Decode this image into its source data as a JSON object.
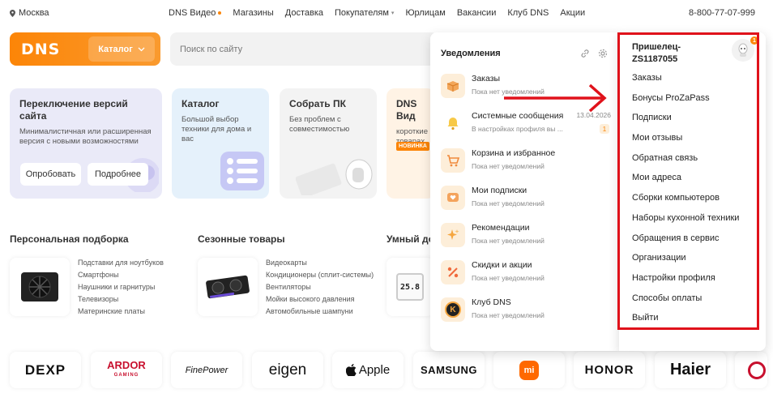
{
  "topbar": {
    "city": "Москва",
    "nav": [
      {
        "label": "DNS Видео",
        "dot": true
      },
      {
        "label": "Магазины"
      },
      {
        "label": "Доставка"
      },
      {
        "label": "Покупателям",
        "chevron": true
      },
      {
        "label": "Юрлицам"
      },
      {
        "label": "Вакансии"
      },
      {
        "label": "Клуб DNS"
      },
      {
        "label": "Акции"
      }
    ],
    "phone": "8-800-77-07-999"
  },
  "header": {
    "logo": "DNS",
    "catalog_label": "Каталог",
    "search_placeholder": "Поиск по сайту"
  },
  "cards": {
    "switch": {
      "title": "Переключение версий сайта",
      "text": "Минималистичная или расширенная версия с новыми возможностями",
      "try_label": "Опробовать",
      "more_label": "Подробнее"
    },
    "catalog": {
      "title": "Каталог",
      "text": "Большой выбор техники для дома и вас"
    },
    "build_pc": {
      "title": "Собрать ПК",
      "text": "Без проблем с совместимостью"
    },
    "video": {
      "title": "DNS Вид",
      "text": "короткие товарах",
      "badge": "НОВИНКА"
    }
  },
  "sections": {
    "personal": {
      "title": "Персональная подборка",
      "items": [
        "Подставки для ноутбуков",
        "Смартфоны",
        "Наушники и гарнитуры",
        "Телевизоры",
        "Материнские платы"
      ]
    },
    "seasonal": {
      "title": "Сезонные товары",
      "items": [
        "Видеокарты",
        "Кондиционеры (сплит-системы)",
        "Вентиляторы",
        "Мойки высокого давления",
        "Автомобильные шампуни"
      ]
    },
    "smart": {
      "title": "Умный до",
      "screen_text": "25.8"
    }
  },
  "brands": [
    "DEXP",
    "ARDOR",
    "FinePower",
    "eigen",
    "Apple",
    "SAMSUNG",
    "mi",
    "HONOR",
    "Haier"
  ],
  "brand_sub": {
    "ardor": "GAMING"
  },
  "notifications": {
    "title": "Уведомления",
    "items": [
      {
        "title": "Заказы",
        "sub": "Пока нет уведомлений",
        "icon": "box-icon",
        "bg": "#fdeed9"
      },
      {
        "title": "Системные сообщения",
        "sub": "В настройках профиля вы ...",
        "date": "13.04.2026",
        "count": "1",
        "icon": "bell-icon",
        "bg": "#ffffff"
      },
      {
        "title": "Корзина и избранное",
        "sub": "Пока нет уведомлений",
        "icon": "cart-icon",
        "bg": "#fdeed9"
      },
      {
        "title": "Мои подписки",
        "sub": "Пока нет уведомлений",
        "icon": "heart-chat-icon",
        "bg": "#fdeed9"
      },
      {
        "title": "Рекомендации",
        "sub": "Пока нет уведомлений",
        "icon": "sparkle-icon",
        "bg": "#fdeed9"
      },
      {
        "title": "Скидки и акции",
        "sub": "Пока нет уведомлений",
        "icon": "percent-icon",
        "bg": "#fdeed9"
      },
      {
        "title": "Клуб DNS",
        "sub": "Пока нет уведомлений",
        "icon": "club-icon",
        "bg": "#fdeed9"
      }
    ],
    "club_letter": "K"
  },
  "profile": {
    "name_line1": "Пришелец-",
    "name_line2": "ZS1187055",
    "avatar_badge": "1",
    "menu": [
      "Заказы",
      "Бонусы ProZaPass",
      "Подписки",
      "Мои отзывы",
      "Обратная связь",
      "Мои адреса",
      "Сборки компьютеров",
      "Наборы кухонной техники",
      "Обращения в сервис",
      "Организации",
      "Настройки профиля",
      "Способы оплаты",
      "Выйти"
    ]
  },
  "colors": {
    "accent": "#fc8507",
    "highlight": "#e0121b"
  }
}
